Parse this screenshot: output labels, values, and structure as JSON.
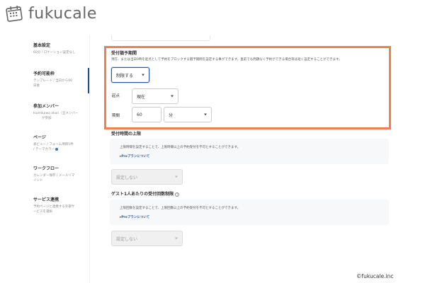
{
  "logo": {
    "text": "fukucale"
  },
  "sidebar": {
    "items": [
      {
        "title": "基本設定",
        "sub": "60分 / ロケーション設定なし"
      },
      {
        "title": "予約可能枠",
        "sub1": "テンプレート / 当日から90",
        "sub2": "日後"
      },
      {
        "title": "参加メンバー",
        "sub1": "Isumikawa akari（全メンバー",
        "sub2": "が参加"
      },
      {
        "title": "ページ",
        "sub1": "表ビュー / フォーム項目5件",
        "sub2": "/ テーマカラー"
      },
      {
        "title": "ワークフロー",
        "sub1": "カレンダー保存 / メールリマ",
        "sub2": "インド"
      },
      {
        "title": "サービス連携",
        "sub1": "予約ページと連携する外部サ",
        "sub2": "ービスを選択"
      }
    ]
  },
  "main": {
    "booking_window": {
      "label": "受付猶予期間",
      "description": "現在、または当日0時を起点として予約をブロックする猶予期間を設定する事ができます。直前でも問題なく予約ができる場合等は短く設定することができます。",
      "limit_select": "制限する",
      "start_label": "起点",
      "start_select": "現在",
      "period_label": "期間",
      "period_value": "60",
      "unit_select": "分"
    },
    "acceptance_cap": {
      "label": "受付時間の上限",
      "info": "上限時間を設定することで、上限時間以上の予約受付を不可とすることができます。",
      "pro_link": "▸Proプランについて",
      "select": "設定しない"
    },
    "guest_limit": {
      "label": "ゲスト1人あたりの受付回数制限",
      "help": "?",
      "info": "上限回数を設定することで、上限回数以上の予約受付を不可とすることができます。",
      "pro_link": "▸Proプランについて",
      "select": "設定しない"
    }
  },
  "footer": {
    "copyright": "©fukucale.inc"
  },
  "colors": {
    "highlight": "#ef7f4f",
    "accent": "#2b57a3"
  }
}
